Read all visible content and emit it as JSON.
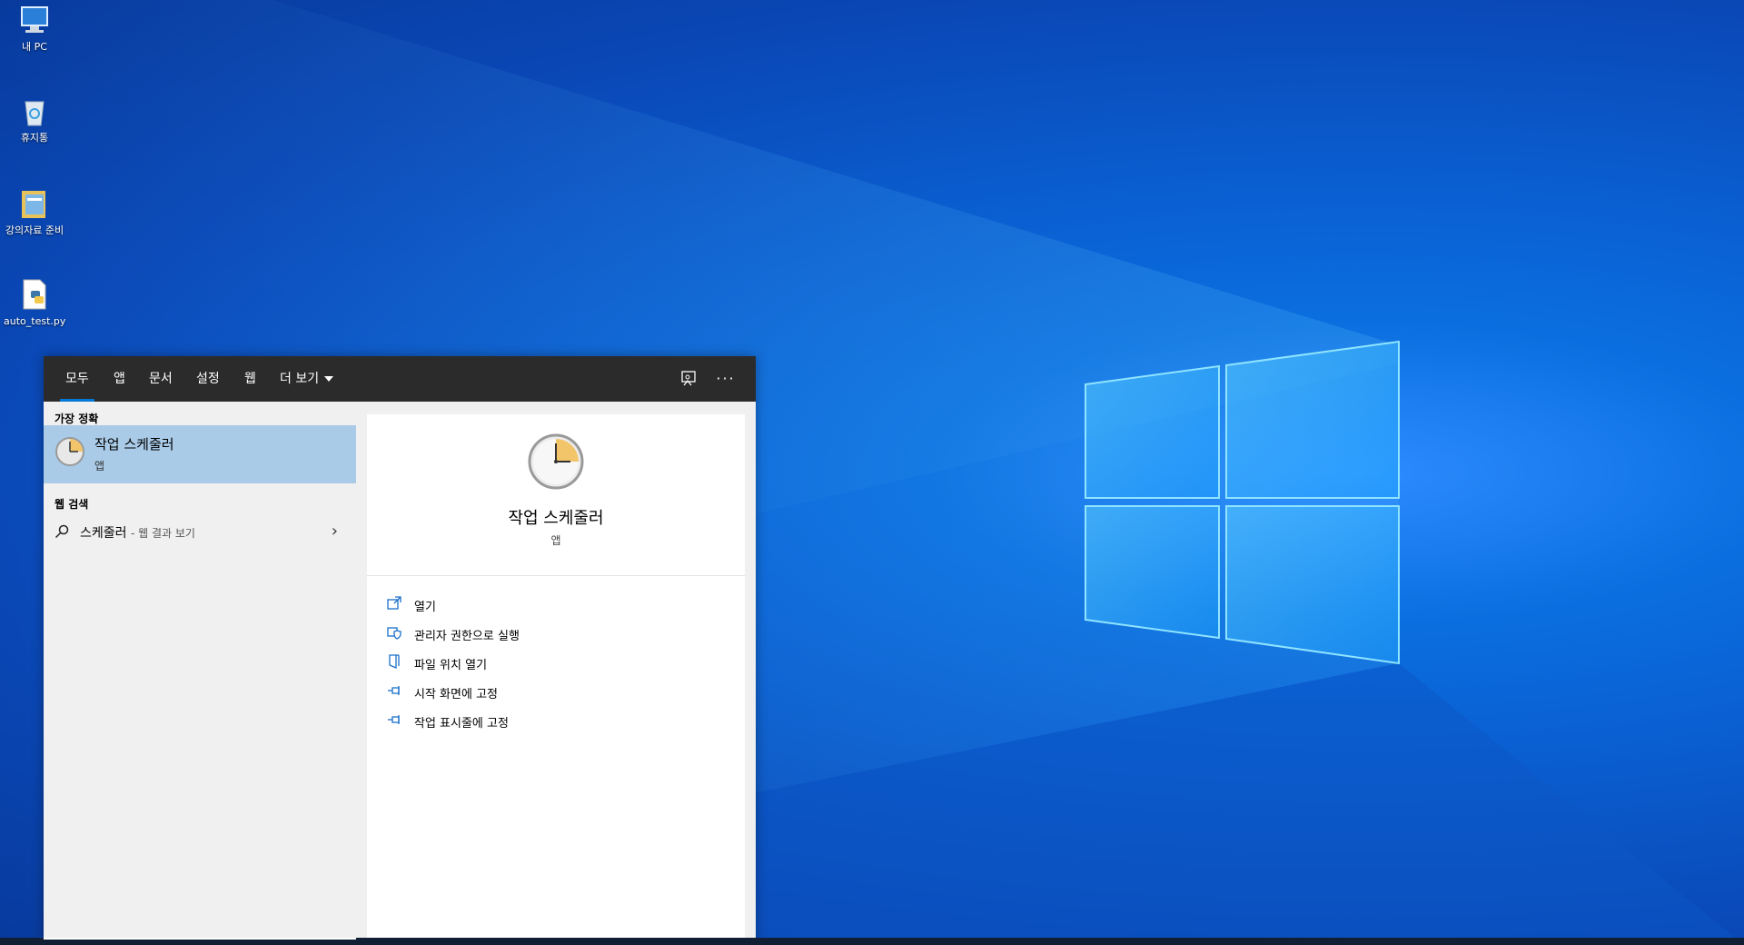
{
  "desktop": {
    "icons": [
      {
        "label": "내 PC",
        "icon": "this-pc-icon"
      },
      {
        "label": "휴지통",
        "icon": "recycle-bin-icon"
      },
      {
        "label": "강의자료 준비",
        "icon": "folder-icon"
      },
      {
        "label": "auto_test.py",
        "icon": "python-file-icon"
      }
    ]
  },
  "search": {
    "tabs": [
      "모두",
      "앱",
      "문서",
      "설정",
      "웹",
      "더 보기"
    ],
    "active_tab": "모두",
    "feedback_icon": "feedback-icon",
    "more_icon": "ellipsis-icon",
    "best_match_heading": "가장 정확",
    "best_match": {
      "title": "작업 스케줄러",
      "type": "앱",
      "icon": "clock-icon"
    },
    "web_heading": "웹 검색",
    "web_result": {
      "query": "스케줄러",
      "hint": "- 웹 결과 보기"
    },
    "detail": {
      "title": "작업 스케줄러",
      "type": "앱",
      "actions": [
        {
          "label": "열기",
          "icon": "open-icon"
        },
        {
          "label": "관리자 권한으로 실행",
          "icon": "admin-shield-icon"
        },
        {
          "label": "파일 위치 열기",
          "icon": "file-location-icon"
        },
        {
          "label": "시작 화면에 고정",
          "icon": "pin-icon"
        },
        {
          "label": "작업 표시줄에 고정",
          "icon": "pin-icon"
        }
      ]
    }
  },
  "colors": {
    "accent": "#0078d7",
    "selection": "#a9cbe8",
    "header_bg": "#2b2b2b"
  }
}
